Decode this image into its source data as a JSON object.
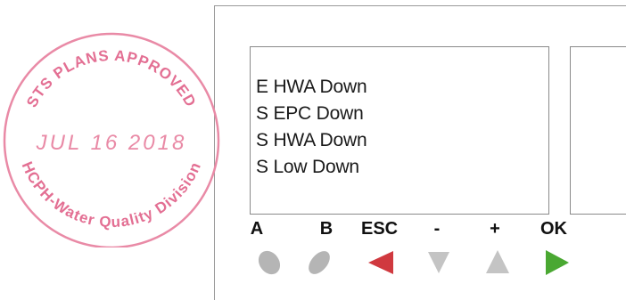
{
  "display": {
    "lines": [
      "E HWA Down",
      "S EPC Down",
      "S HWA Down",
      "S Low Down"
    ]
  },
  "buttons": [
    {
      "label": "A",
      "icon": "oval-button-icon",
      "color": "#b3b3b3"
    },
    {
      "label": "B",
      "icon": "oval-button-icon",
      "color": "#b3b3b3"
    },
    {
      "label": "ESC",
      "icon": "left-arrow-icon",
      "color": "#d0393f"
    },
    {
      "label": "-",
      "icon": "down-arrow-icon",
      "color": "#c0c0c0"
    },
    {
      "label": "+",
      "icon": "up-arrow-icon",
      "color": "#c0c0c0"
    },
    {
      "label": "OK",
      "icon": "right-arrow-icon",
      "color": "#4aa832"
    }
  ],
  "stamp": {
    "top_text": "STS PLANS APPROVED",
    "date": "JUL 16 2018",
    "bottom_text": "HCPH-Water Quality Division",
    "color": "#e98aa6"
  }
}
